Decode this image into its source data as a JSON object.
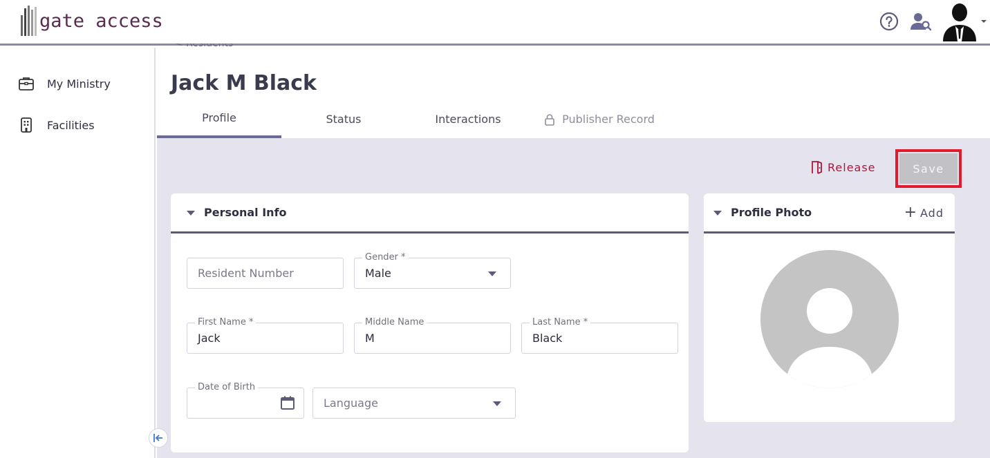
{
  "header": {
    "logo_text": "gate access",
    "icons": [
      "help-icon",
      "people-search-icon",
      "user-avatar",
      "chevron-down-icon"
    ]
  },
  "sidebar": {
    "items": [
      {
        "label": "My Ministry",
        "icon": "briefcase-icon"
      },
      {
        "label": "Facilities",
        "icon": "building-icon"
      }
    ],
    "collapse_icon": "collapse-left-icon"
  },
  "breadcrumb": "< Residents",
  "page_title": "Jack M Black",
  "tabs": [
    {
      "label": "Profile",
      "active": true
    },
    {
      "label": "Status"
    },
    {
      "label": "Interactions"
    },
    {
      "label": "Publisher Record",
      "locked": true
    }
  ],
  "actions": {
    "release_label": "Release",
    "save_label": "Save"
  },
  "personal_info": {
    "title": "Personal Info",
    "resident_number_placeholder": "Resident Number",
    "gender_label": "Gender *",
    "gender_value": "Male",
    "first_name_label": "First Name *",
    "first_name_value": "Jack",
    "middle_name_label": "Middle Name",
    "middle_name_value": "M",
    "last_name_label": "Last Name *",
    "last_name_value": "Black",
    "dob_label": "Date of Birth",
    "language_placeholder": "Language"
  },
  "profile_photo": {
    "title": "Profile Photo",
    "add_label": "Add"
  },
  "colors": {
    "accent": "#6b6995",
    "release": "#b0163a",
    "highlight_outline": "#e21b2c",
    "content_bg": "#e4e3ee"
  }
}
